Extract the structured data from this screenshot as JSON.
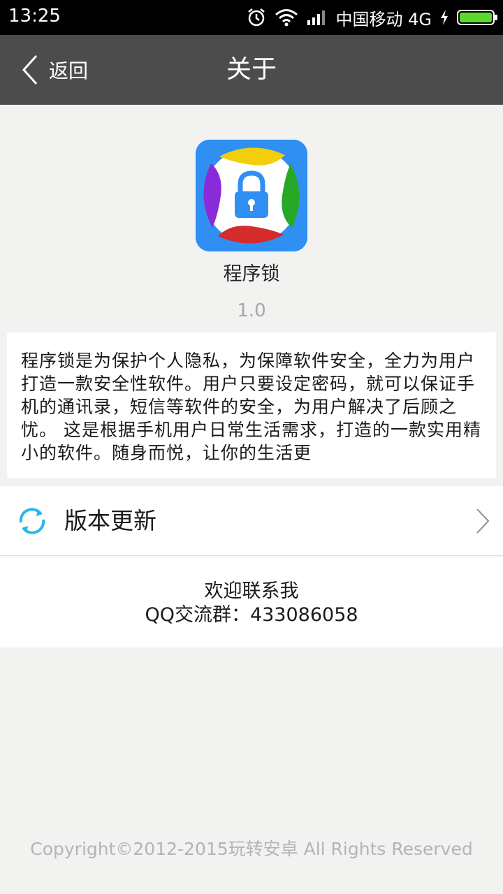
{
  "status_bar": {
    "time": "13:25",
    "carrier": "中国移动 4G",
    "battery_color": "#5ad82e"
  },
  "header": {
    "back_label": "返回",
    "title": "关于",
    "background": "#4c4c4c"
  },
  "app": {
    "name": "程序锁",
    "version": "1.0",
    "icon": "lock-app-icon"
  },
  "description": "程序锁是为保护个人隐私，为保障软件安全，全力为用户打造一款安全性软件。用户只要设定密码，就可以保证手机的通讯录，短信等软件的安全，为用户解决了后顾之忧。 这是根据手机用户日常生活需求，打造的一款实用精小的软件。随身而悦，让你的生活更",
  "update_row": {
    "label": "版本更新",
    "icon": "refresh-icon",
    "icon_color": "#29b6e8"
  },
  "contact": {
    "line1": "欢迎联系我",
    "line2": "QQ交流群：433086058"
  },
  "footer": {
    "copyright": "Copyright©2012-2015玩转安卓 All Rights Reserved"
  }
}
